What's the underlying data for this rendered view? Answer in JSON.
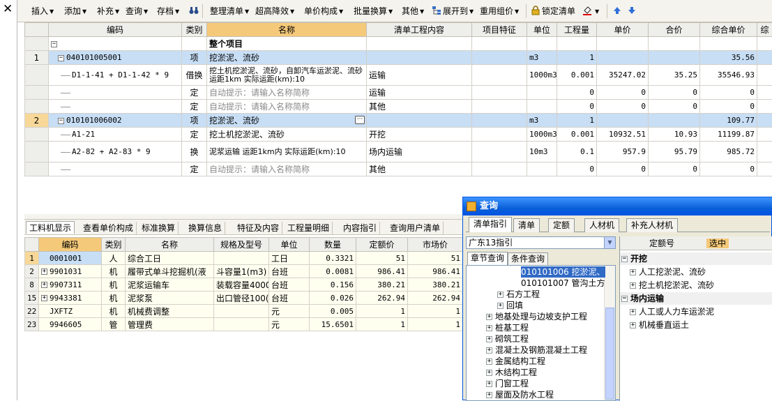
{
  "close_label": "✕",
  "toolbar": {
    "items": [
      "插入",
      "添加",
      "补充",
      "查询",
      "存档",
      "整理清单",
      "超高降效",
      "单价构成",
      "批量换算",
      "其他",
      "展开到",
      "重用组价",
      "锁定清单"
    ]
  },
  "top_grid": {
    "headers": [
      "编码",
      "类别",
      "名称",
      "清单工程内容",
      "项目特征",
      "单位",
      "工程量",
      "单价",
      "合价",
      "综合单价",
      "综"
    ],
    "total_row": {
      "toggle": "−",
      "name": "整个项目"
    },
    "rows": [
      {
        "num": "1",
        "code": "040101005001",
        "type": "项",
        "name": "挖淤泥、流砂",
        "content": "",
        "unit": "m3",
        "qty": "1",
        "price": "",
        "total": "",
        "unit_price": "35.56",
        "level": 1
      },
      {
        "num": "",
        "code": "D1-1-41 + D1-1-42 * 9",
        "type": "借换",
        "name": "挖土机挖淤泥、流砂，自卸汽车运淤泥、流砂 运距1km 实际运距(km):10",
        "content": "运输",
        "unit": "1000m3",
        "qty": "0.001",
        "price": "35247.02",
        "total": "35.25",
        "unit_price": "35546.93",
        "level": 2
      },
      {
        "num": "",
        "code": "",
        "type": "定",
        "name": "自动提示：请输入名称简称",
        "content": "运输",
        "unit": "",
        "qty": "0",
        "price": "0",
        "total": "0",
        "unit_price": "0",
        "level": 2,
        "hint": true
      },
      {
        "num": "",
        "code": "",
        "type": "定",
        "name": "自动提示：请输入名称简称",
        "content": "其他",
        "unit": "",
        "qty": "0",
        "price": "0",
        "total": "0",
        "unit_price": "0",
        "level": 2,
        "hint": true
      },
      {
        "num": "2",
        "code": "010101006002",
        "type": "项",
        "name": "挖淤泥、流砂",
        "content": "",
        "unit": "m3",
        "qty": "1",
        "price": "",
        "total": "",
        "unit_price": "109.77",
        "level": 1,
        "selected": true
      },
      {
        "num": "",
        "code": "A1-21",
        "type": "定",
        "name": "挖土机挖淤泥、流砂",
        "content": "开挖",
        "unit": "1000m3",
        "qty": "0.001",
        "price": "10932.51",
        "total": "10.93",
        "unit_price": "11199.87",
        "level": 2
      },
      {
        "num": "",
        "code": "A2-82 + A2-83 * 9",
        "type": "换",
        "name": "泥浆运输 运距1km内 实际运距(km):10",
        "content": "场内运输",
        "unit": "10m3",
        "qty": "0.1",
        "price": "957.9",
        "total": "95.79",
        "unit_price": "985.72",
        "level": 2
      },
      {
        "num": "",
        "code": "",
        "type": "定",
        "name": "自动提示：请输入名称简称",
        "content": "其他",
        "unit": "",
        "qty": "0",
        "price": "0",
        "total": "0",
        "unit_price": "0",
        "level": 2,
        "hint": true
      }
    ]
  },
  "bottom_tabs": [
    "工料机显示",
    "查看单价构成",
    "标准换算",
    "换算信息",
    "特征及内容",
    "工程量明细",
    "内容指引",
    "查询用户清单"
  ],
  "bottom_grid": {
    "headers": [
      "编码",
      "类别",
      "名称",
      "规格及型号",
      "单位",
      "数量",
      "定额价",
      "市场价"
    ],
    "rows": [
      {
        "num": "1",
        "expand": "",
        "code": "0001001",
        "type": "人",
        "name": "综合工日",
        "spec": "",
        "unit": "工日",
        "qty": "0.3321",
        "quota": "51",
        "market": "51",
        "selected": true
      },
      {
        "num": "2",
        "expand": "+",
        "code": "9901031",
        "type": "机",
        "name": "履带式单斗挖掘机(液",
        "spec": "斗容量1(m3)",
        "unit": "台班",
        "qty": "0.0081",
        "quota": "986.41",
        "market": "986.41"
      },
      {
        "num": "8",
        "expand": "+",
        "code": "9907311",
        "type": "机",
        "name": "泥浆运输车",
        "spec": "装载容量4000",
        "unit": "台班",
        "qty": "0.156",
        "quota": "380.21",
        "market": "380.21"
      },
      {
        "num": "15",
        "expand": "+",
        "code": "9943381",
        "type": "机",
        "name": "泥浆泵",
        "spec": "出口管径100(",
        "unit": "台班",
        "qty": "0.026",
        "quota": "262.94",
        "market": "262.94"
      },
      {
        "num": "22",
        "expand": "",
        "code": "JXFTZ",
        "type": "机",
        "name": "机械费调整",
        "spec": "",
        "unit": "元",
        "qty": "0.005",
        "quota": "1",
        "market": "1"
      },
      {
        "num": "23",
        "expand": "",
        "code": "9946605",
        "type": "管",
        "name": "管理费",
        "spec": "",
        "unit": "元",
        "qty": "15.6501",
        "quota": "1",
        "market": "1"
      }
    ]
  },
  "query_dialog": {
    "title": "查询",
    "tabs": [
      "清单指引",
      "清单",
      "定额",
      "人材机",
      "补充人材机"
    ],
    "combo_value": "广东13指引",
    "subtabs": [
      "章节查询",
      "条件查询"
    ],
    "tree": [
      {
        "text": "010101006   挖淤泥、",
        "indent": 78,
        "toggle": "",
        "hi": true
      },
      {
        "text": "010101007   管沟土方",
        "indent": 78,
        "toggle": ""
      },
      {
        "text": "石方工程",
        "indent": 44,
        "toggle": "+"
      },
      {
        "text": "回填",
        "indent": 44,
        "toggle": "+"
      },
      {
        "text": "地基处理与边坡支护工程",
        "indent": 28,
        "toggle": "+"
      },
      {
        "text": "桩基工程",
        "indent": 28,
        "toggle": "+"
      },
      {
        "text": "砌筑工程",
        "indent": 28,
        "toggle": "+"
      },
      {
        "text": "混凝土及钢筋混凝土工程",
        "indent": 28,
        "toggle": "+"
      },
      {
        "text": "金属结构工程",
        "indent": 28,
        "toggle": "+"
      },
      {
        "text": "木结构工程",
        "indent": 28,
        "toggle": "+"
      },
      {
        "text": "门窗工程",
        "indent": 28,
        "toggle": "+"
      },
      {
        "text": "屋面及防水工程",
        "indent": 28,
        "toggle": "+"
      }
    ],
    "right_headers": [
      "定额号",
      "选中"
    ],
    "groups": [
      {
        "name": "开挖",
        "toggle": "−",
        "items": [
          "人工挖淤泥、流砂",
          "挖土机挖淤泥、流砂"
        ]
      },
      {
        "name": "场内运输",
        "toggle": "−",
        "items": [
          "人工或人力车运淤泥",
          "机械垂直运土"
        ]
      }
    ]
  },
  "colors": {
    "selected_row": "#c7def5",
    "row_marker": "#f7d898",
    "title_bar": "#0054e3",
    "yellow_grid": "#fffff0"
  }
}
